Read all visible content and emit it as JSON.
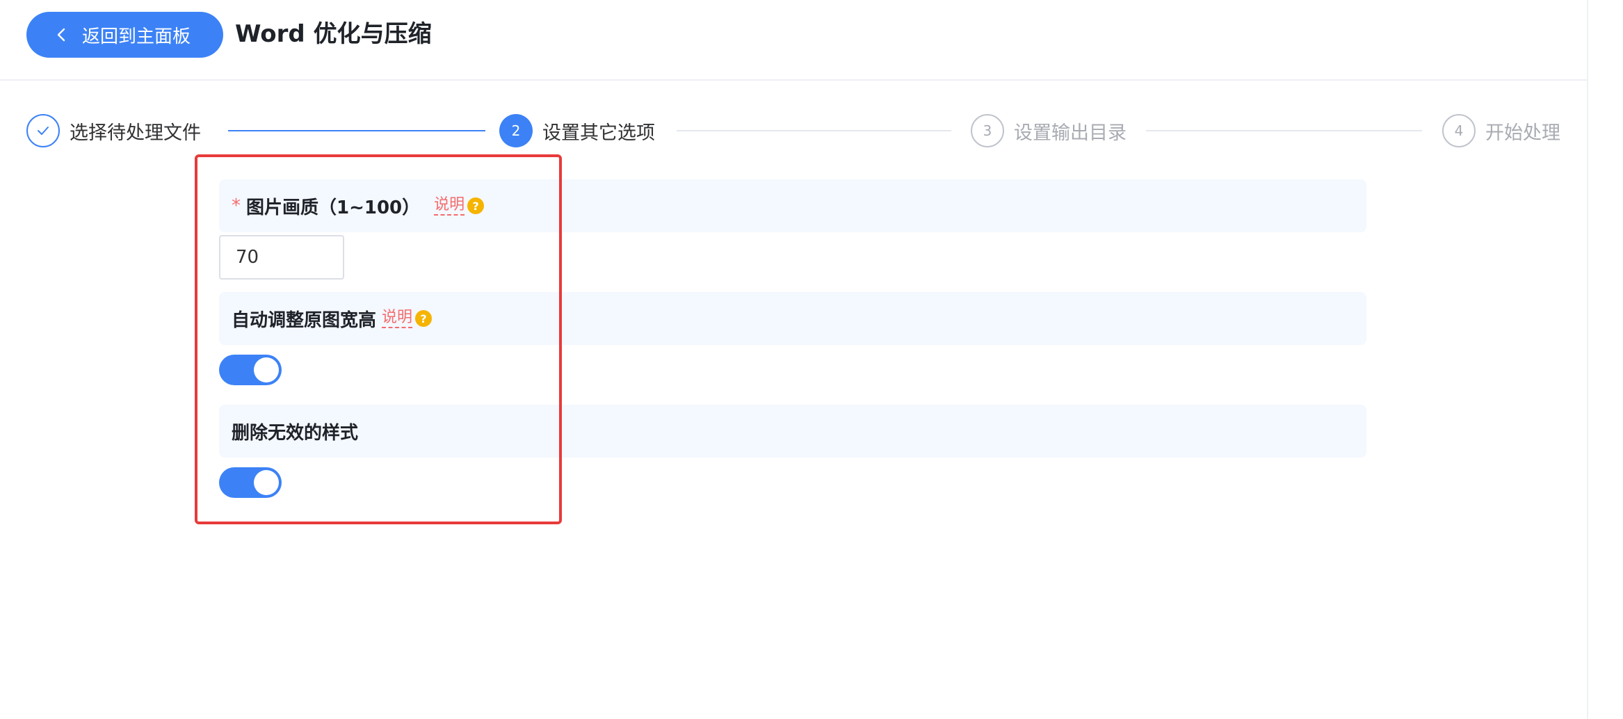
{
  "header": {
    "back_label": "返回到主面板",
    "title": "Word 优化与压缩"
  },
  "steps": [
    {
      "label": "选择待处理文件",
      "state": "done",
      "number": "✓"
    },
    {
      "label": "设置其它选项",
      "state": "active",
      "number": "2"
    },
    {
      "label": "设置输出目录",
      "state": "todo",
      "number": "3"
    },
    {
      "label": "开始处理",
      "state": "todo",
      "number": "4"
    }
  ],
  "form": {
    "quality": {
      "label": "图片画质（1~100）",
      "required": true,
      "explain": "说明",
      "value": "70"
    },
    "auto_resize": {
      "label": "自动调整原图宽高",
      "explain": "说明",
      "enabled": true
    },
    "remove_styles": {
      "label": "删除无效的样式",
      "enabled": true
    }
  },
  "colors": {
    "accent": "#3c82f6",
    "highlight": "#e83a3a",
    "required": "#f56c6c",
    "help": "#f5b400"
  }
}
